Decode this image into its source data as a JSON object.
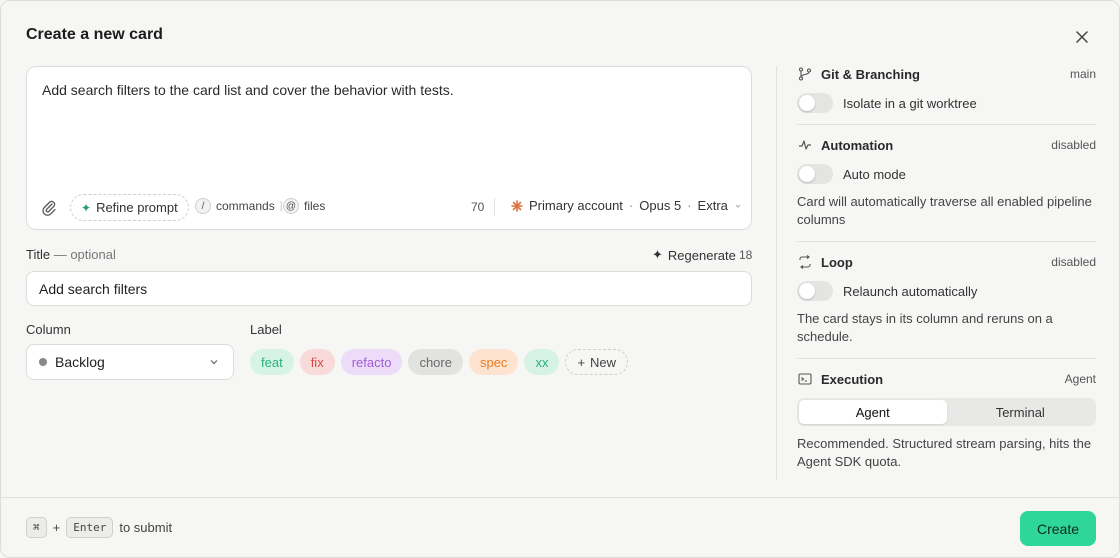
{
  "dialog": {
    "title": "Create a new card",
    "close_icon": "close-icon"
  },
  "prompt": {
    "text": "Add search filters to the card list and cover the behavior with tests.",
    "refine_label": "Refine prompt",
    "commands_key": "/",
    "commands_label": "commands",
    "files_key": "@",
    "files_label": "files",
    "char_count": "70",
    "account": "Primary account",
    "model": "Opus 5",
    "effort": "Extra"
  },
  "title_field": {
    "label": "Title",
    "optional": "— optional",
    "regenerate_label": "Regenerate",
    "regenerate_count": "18",
    "value": "Add search filters"
  },
  "column": {
    "label": "Column",
    "value": "Backlog"
  },
  "labels": {
    "label": "Label",
    "items": [
      {
        "name": "feat",
        "bg": "#d7f3e6",
        "fg": "#29b27a"
      },
      {
        "name": "fix",
        "bg": "#f8dada",
        "fg": "#e04848"
      },
      {
        "name": "refacto",
        "bg": "#ecdcfa",
        "fg": "#a45ad8"
      },
      {
        "name": "chore",
        "bg": "#e2e2e0",
        "fg": "#6b6b6b"
      },
      {
        "name": "spec",
        "bg": "#fde3d0",
        "fg": "#ec7a22"
      },
      {
        "name": "xx",
        "bg": "#d7f3e6",
        "fg": "#29b27a"
      }
    ],
    "new_label": "New"
  },
  "sidebar": {
    "git": {
      "title": "Git & Branching",
      "meta": "main",
      "toggle_label": "Isolate in a git worktree"
    },
    "automation": {
      "title": "Automation",
      "meta": "disabled",
      "toggle_label": "Auto mode",
      "desc": "Card will automatically traverse all enabled pipeline columns"
    },
    "loop": {
      "title": "Loop",
      "meta": "disabled",
      "toggle_label": "Relaunch automatically",
      "desc": "The card stays in its column and reruns on a schedule."
    },
    "execution": {
      "title": "Execution",
      "meta": "Agent",
      "options": [
        "Agent",
        "Terminal"
      ],
      "selected": "Agent",
      "desc": "Recommended. Structured stream parsing, hits the Agent SDK quota."
    }
  },
  "footer": {
    "key1": "⌘",
    "plus": "+",
    "key2": "Enter",
    "hint": "to submit",
    "create_label": "Create"
  },
  "colors": {
    "accent": "#2fd69a"
  }
}
